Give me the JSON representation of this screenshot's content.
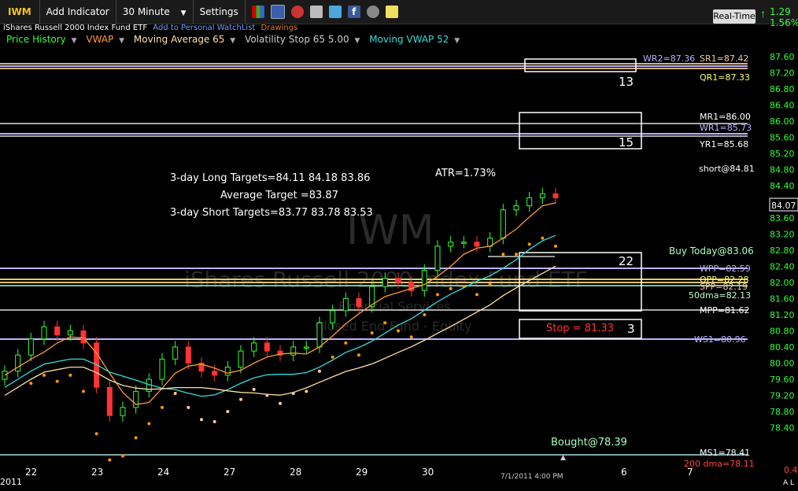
{
  "toolbar": {
    "symbol": "IWM",
    "add_indicator": "Add Indicator",
    "interval": "30 Minute",
    "settings": "Settings",
    "realtime": "Real-Time",
    "change": "1.29",
    "change_pct": "1.56%"
  },
  "subheader": {
    "name": "iShares Russell 2000 Index Fund ETF",
    "watchlist": "Add to Personal WatchList",
    "drawings": "Drawings"
  },
  "indicators": [
    {
      "label": "Price History",
      "color": "#33ff33"
    },
    {
      "label": "VWAP",
      "color": "#ff9933"
    },
    {
      "label": "Moving Average 65",
      "color": "#ffe0a0"
    },
    {
      "label": "Volatility Stop 65 5.00",
      "color": "#cccccc"
    },
    {
      "label": "Moving VWAP 52",
      "color": "#33dddd"
    }
  ],
  "watermark": {
    "symbol": "IWM",
    "name": "iShares Russell 2000 Index Fund ETF",
    "sector": "Financial Services",
    "industry": "Closed End Fund - Equity"
  },
  "annotations": {
    "long_targets": "3-day Long Targets=84.11 84.18 83.86",
    "avg_target": "Average Target =83.87",
    "short_targets": "3-day Short Targets=83.77 83.78 83.53",
    "atr": "ATR=1.73%",
    "short_level": "short@84.81",
    "buy_today": "Buy Today@83.06",
    "bought": "Bought@78.39",
    "stop": "Stop = 81.33",
    "box1": "13",
    "box2": "15",
    "box3": "22",
    "box4": "3",
    "timestamp": "7/1/2011 4:00 PM",
    "last_price": "84.07",
    "year": "2011",
    "bottom_right": "0.4",
    "corner": "A L"
  },
  "levels": [
    {
      "label": "WR2=87.36",
      "color": "#b9b3ff"
    },
    {
      "label": "SR1=87.42",
      "color": "#f0c89a"
    },
    {
      "label": "QR1=87.33",
      "color": "#ffff66"
    },
    {
      "label": "MR1=86.00",
      "color": "#ffffff"
    },
    {
      "label": "WR1=85.73",
      "color": "#b9b3ff"
    },
    {
      "label": "YR1=85.68",
      "color": "#ffffff"
    },
    {
      "label": "WPP=82.59",
      "color": "#b9b3ff"
    },
    {
      "label": "QPP=82.28",
      "color": "#ffff66"
    },
    {
      "label": "SPP=82.19",
      "color": "#f0c89a"
    },
    {
      "label": "50dma=82.13",
      "color": "#bbffcc"
    },
    {
      "label": "MPP=81.62",
      "color": "#ffffff"
    },
    {
      "label": "WS1=80.96",
      "color": "#b9b3ff"
    },
    {
      "label": "MS1=78.41",
      "color": "#ffffff"
    },
    {
      "label": "200 dma=78.11",
      "color": "#ff4444"
    }
  ],
  "chart_data": {
    "type": "candlestick",
    "y_ticks": [
      "87.60",
      "87.20",
      "86.80",
      "86.40",
      "86.00",
      "85.60",
      "85.20",
      "84.80",
      "84.40",
      "84.00",
      "83.60",
      "83.20",
      "82.80",
      "82.40",
      "82.00",
      "81.60",
      "81.20",
      "80.80",
      "80.40",
      "80.00",
      "79.60",
      "79.20",
      "78.80",
      "78.40"
    ],
    "x_ticks": [
      "22",
      "23",
      "24",
      "27",
      "28",
      "29",
      "30",
      "6",
      "7"
    ],
    "ylim": [
      78.2,
      87.8
    ],
    "close_series": [
      79.8,
      80.2,
      80.6,
      80.9,
      80.7,
      80.8,
      80.5,
      79.4,
      78.7,
      78.9,
      79.3,
      79.6,
      80.1,
      80.4,
      80.0,
      79.8,
      79.7,
      79.9,
      80.3,
      80.5,
      80.3,
      80.2,
      80.4,
      80.4,
      81.0,
      81.3,
      81.6,
      81.4,
      81.9,
      82.1,
      82.0,
      81.8,
      82.3,
      82.9,
      83.0,
      83.0,
      82.9,
      83.1,
      83.8,
      83.9,
      84.1,
      84.2,
      84.1
    ]
  }
}
